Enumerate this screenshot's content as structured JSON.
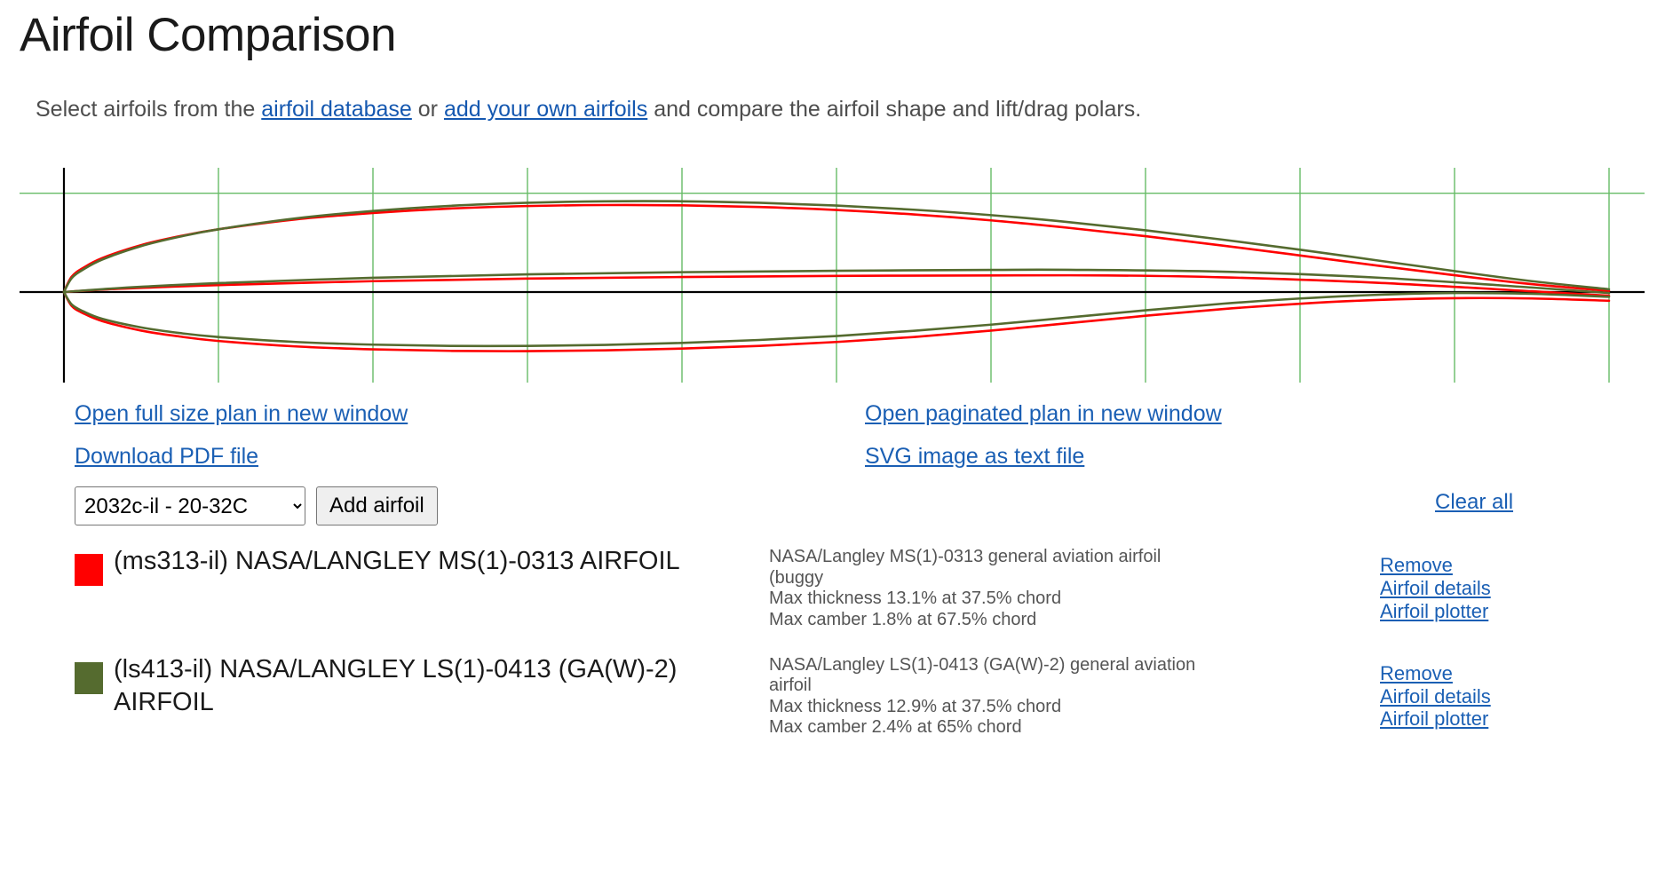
{
  "header": {
    "title": "Airfoil Comparison",
    "intro_part1": "Select airfoils from the ",
    "intro_link1": "airfoil database",
    "intro_part2": " or ",
    "intro_link2": "add your own airfoils",
    "intro_part3": " and compare the airfoil shape and lift/drag polars."
  },
  "plot_links": {
    "full_size": "Open full size plan in new window",
    "paginated": "Open paginated plan in new window",
    "download_pdf": "Download PDF file",
    "svg_text": "SVG image as text file"
  },
  "selector": {
    "selected_option": "2032c-il - 20-32C",
    "add_button": "Add airfoil",
    "clear_all": "Clear all"
  },
  "actions": {
    "remove": "Remove",
    "details": "Airfoil details",
    "plotter": "Airfoil plotter"
  },
  "airfoils": [
    {
      "color": "#FF0000",
      "name": "(ms313-il) NASA/LANGLEY MS(1)-0313 AIRFOIL",
      "desc_line1": "NASA/Langley MS(1)-0313 general aviation airfoil",
      "desc_line2": "(buggy",
      "desc_line3": "Max thickness 13.1% at 37.5% chord",
      "desc_line4": "Max camber 1.8% at 67.5% chord"
    },
    {
      "color": "#556B2F",
      "name": "(ls413-il) NASA/LANGLEY LS(1)-0413 (GA(W)-2) AIRFOIL",
      "desc_line1": "NASA/Langley LS(1)-0413 (GA(W)-2) general aviation",
      "desc_line2": "airfoil",
      "desc_line3": "Max thickness 12.9% at 37.5% chord",
      "desc_line4": "Max camber 2.4% at 65% chord"
    }
  ],
  "chart_data": {
    "type": "line",
    "title": "",
    "xlabel": "",
    "ylabel": "",
    "grid": true,
    "axis_color": "#000000",
    "grid_color": "#66bb66",
    "xlim": [
      0,
      1.0
    ],
    "ylim": [
      -0.12,
      0.12
    ],
    "x_gridlines": [
      0.0,
      0.1,
      0.2,
      0.3,
      0.4,
      0.5,
      0.6,
      0.7,
      0.8,
      0.9,
      1.0
    ],
    "y_gridlines": [
      -0.1,
      0.0,
      0.1
    ],
    "series": [
      {
        "name": "(ms313-il) NASA/LANGLEY MS(1)-0313 AIRFOIL",
        "color": "#FF0000",
        "max_thickness_pct": 13.1,
        "max_thickness_chord_pct": 37.5,
        "max_camber_pct": 1.8,
        "max_camber_chord_pct": 67.5,
        "upper": [
          [
            0.0,
            0.0
          ],
          [
            0.005,
            0.0155
          ],
          [
            0.0125,
            0.0245
          ],
          [
            0.025,
            0.0345
          ],
          [
            0.05,
            0.0475
          ],
          [
            0.075,
            0.0565
          ],
          [
            0.1,
            0.0635
          ],
          [
            0.15,
            0.0735
          ],
          [
            0.2,
            0.08
          ],
          [
            0.25,
            0.0845
          ],
          [
            0.3,
            0.087
          ],
          [
            0.35,
            0.088
          ],
          [
            0.4,
            0.0877
          ],
          [
            0.45,
            0.086
          ],
          [
            0.5,
            0.083
          ],
          [
            0.55,
            0.0785
          ],
          [
            0.6,
            0.0725
          ],
          [
            0.65,
            0.065
          ],
          [
            0.7,
            0.0565
          ],
          [
            0.75,
            0.047
          ],
          [
            0.8,
            0.037
          ],
          [
            0.85,
            0.0268
          ],
          [
            0.9,
            0.017
          ],
          [
            0.95,
            0.008
          ],
          [
            1.0,
            0.0012
          ]
        ],
        "lower": [
          [
            0.0,
            0.0
          ],
          [
            0.005,
            -0.014
          ],
          [
            0.0125,
            -0.0215
          ],
          [
            0.025,
            -0.0295
          ],
          [
            0.05,
            -0.039
          ],
          [
            0.075,
            -0.045
          ],
          [
            0.1,
            -0.0495
          ],
          [
            0.15,
            -0.055
          ],
          [
            0.2,
            -0.058
          ],
          [
            0.25,
            -0.0595
          ],
          [
            0.3,
            -0.0598
          ],
          [
            0.35,
            -0.059
          ],
          [
            0.4,
            -0.0572
          ],
          [
            0.45,
            -0.0545
          ],
          [
            0.5,
            -0.0505
          ],
          [
            0.55,
            -0.0455
          ],
          [
            0.6,
            -0.039
          ],
          [
            0.65,
            -0.0315
          ],
          [
            0.7,
            -0.024
          ],
          [
            0.75,
            -0.0172
          ],
          [
            0.8,
            -0.0118
          ],
          [
            0.85,
            -0.008
          ],
          [
            0.9,
            -0.0062
          ],
          [
            0.95,
            -0.0065
          ],
          [
            1.0,
            -0.0088
          ]
        ],
        "camber": [
          [
            0.0,
            0.0
          ],
          [
            0.025,
            0.0025
          ],
          [
            0.05,
            0.0042
          ],
          [
            0.1,
            0.007
          ],
          [
            0.2,
            0.011
          ],
          [
            0.3,
            0.0136
          ],
          [
            0.4,
            0.0152
          ],
          [
            0.5,
            0.0163
          ],
          [
            0.6,
            0.0168
          ],
          [
            0.675,
            0.0168
          ],
          [
            0.75,
            0.0149
          ],
          [
            0.85,
            0.0094
          ],
          [
            0.95,
            0.0008
          ],
          [
            1.0,
            -0.0038
          ]
        ]
      },
      {
        "name": "(ls413-il) NASA/LANGLEY LS(1)-0413 (GA(W)-2) AIRFOIL",
        "color": "#556B2F",
        "max_thickness_pct": 12.9,
        "max_thickness_chord_pct": 37.5,
        "max_camber_pct": 2.4,
        "max_camber_chord_pct": 65,
        "upper": [
          [
            0.0,
            0.0
          ],
          [
            0.005,
            0.014
          ],
          [
            0.0125,
            0.0228
          ],
          [
            0.025,
            0.033
          ],
          [
            0.05,
            0.0465
          ],
          [
            0.075,
            0.056
          ],
          [
            0.1,
            0.0635
          ],
          [
            0.15,
            0.0745
          ],
          [
            0.2,
            0.082
          ],
          [
            0.25,
            0.0872
          ],
          [
            0.3,
            0.0903
          ],
          [
            0.35,
            0.0918
          ],
          [
            0.4,
            0.0918
          ],
          [
            0.45,
            0.0903
          ],
          [
            0.5,
            0.0875
          ],
          [
            0.55,
            0.0833
          ],
          [
            0.6,
            0.0778
          ],
          [
            0.65,
            0.0708
          ],
          [
            0.7,
            0.0625
          ],
          [
            0.75,
            0.053
          ],
          [
            0.8,
            0.0428
          ],
          [
            0.85,
            0.032
          ],
          [
            0.9,
            0.0212
          ],
          [
            0.95,
            0.011
          ],
          [
            1.0,
            0.0028
          ]
        ],
        "lower": [
          [
            0.0,
            0.0
          ],
          [
            0.005,
            -0.0125
          ],
          [
            0.0125,
            -0.0195
          ],
          [
            0.025,
            -0.0272
          ],
          [
            0.05,
            -0.0358
          ],
          [
            0.075,
            -0.0415
          ],
          [
            0.1,
            -0.0455
          ],
          [
            0.15,
            -0.0505
          ],
          [
            0.2,
            -0.0532
          ],
          [
            0.25,
            -0.0545
          ],
          [
            0.3,
            -0.0545
          ],
          [
            0.35,
            -0.0535
          ],
          [
            0.4,
            -0.0515
          ],
          [
            0.45,
            -0.0485
          ],
          [
            0.5,
            -0.0445
          ],
          [
            0.55,
            -0.0392
          ],
          [
            0.6,
            -0.033
          ],
          [
            0.65,
            -0.0258
          ],
          [
            0.7,
            -0.0185
          ],
          [
            0.75,
            -0.0118
          ],
          [
            0.8,
            -0.0065
          ],
          [
            0.85,
            -0.0028
          ],
          [
            0.9,
            -0.001
          ],
          [
            0.95,
            -0.0018
          ],
          [
            1.0,
            -0.0048
          ]
        ],
        "camber": [
          [
            0.0,
            0.0
          ],
          [
            0.025,
            0.0029
          ],
          [
            0.05,
            0.0053
          ],
          [
            0.1,
            0.009
          ],
          [
            0.2,
            0.0144
          ],
          [
            0.3,
            0.0179
          ],
          [
            0.4,
            0.0201
          ],
          [
            0.5,
            0.0215
          ],
          [
            0.6,
            0.0224
          ],
          [
            0.65,
            0.0225
          ],
          [
            0.75,
            0.0206
          ],
          [
            0.85,
            0.0146
          ],
          [
            0.95,
            0.0046
          ],
          [
            1.0,
            -0.001
          ]
        ]
      }
    ]
  }
}
